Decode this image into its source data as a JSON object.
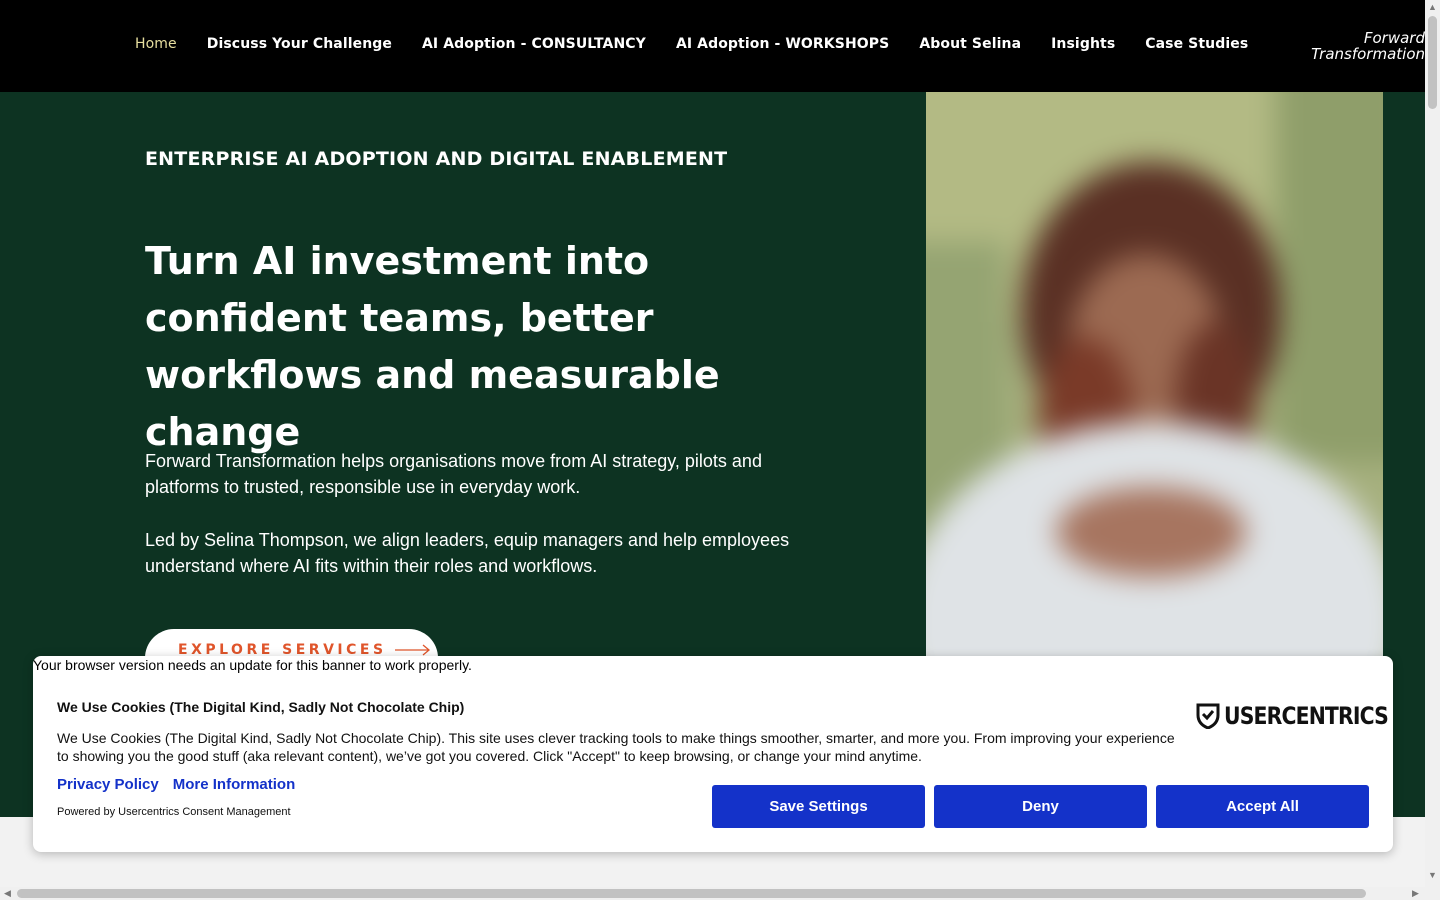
{
  "nav": {
    "items": [
      {
        "label": "Home",
        "active": true
      },
      {
        "label": "Discuss Your Challenge"
      },
      {
        "label": "AI Adoption - CONSULTANCY"
      },
      {
        "label": "AI Adoption - WORKSHOPS"
      },
      {
        "label": "About Selina"
      },
      {
        "label": "Insights"
      },
      {
        "label": "Case Studies"
      }
    ]
  },
  "brand": {
    "line1": "Forward",
    "line2": "Transformation"
  },
  "hero": {
    "eyebrow": "ENTERPRISE AI ADOPTION AND DIGITAL ENABLEMENT",
    "headline": "Turn AI investment into confident teams, better workflows and measurable change",
    "paragraph1": "Forward Transformation helps organisations move from AI strategy, pilots and platforms to trusted, responsible use in everyday work.",
    "paragraph2": "Led by Selina Thompson, we align leaders, equip managers and help employees understand where AI fits within their roles and workflows.",
    "cta_label": "EXPLORE SERVICES"
  },
  "browser_notice": "Your browser version needs an update for this banner to work properly.",
  "cookie": {
    "title": "We Use Cookies (The Digital Kind, Sadly Not Chocolate Chip)",
    "body": "We Use Cookies (The Digital Kind, Sadly Not Chocolate Chip). This site uses clever tracking tools to make things smoother, smarter, and more you. From improving your experience to showing you the good stuff (aka relevant content), we’ve got you covered. Click \"Accept\" to keep browsing, or change your mind anytime.",
    "privacy_link": "Privacy Policy",
    "more_link": "More Information",
    "powered_by": "Powered by Usercentrics Consent Management",
    "logo_text": "USERCENTRICS",
    "buttons": {
      "save": "Save Settings",
      "deny": "Deny",
      "accept": "Accept All"
    }
  },
  "colors": {
    "nav_bg": "#000000",
    "hero_bg": "#0d3322",
    "nav_active": "#e8dfa0",
    "cta_text": "#e0552b",
    "cookie_button": "#1432c9"
  }
}
